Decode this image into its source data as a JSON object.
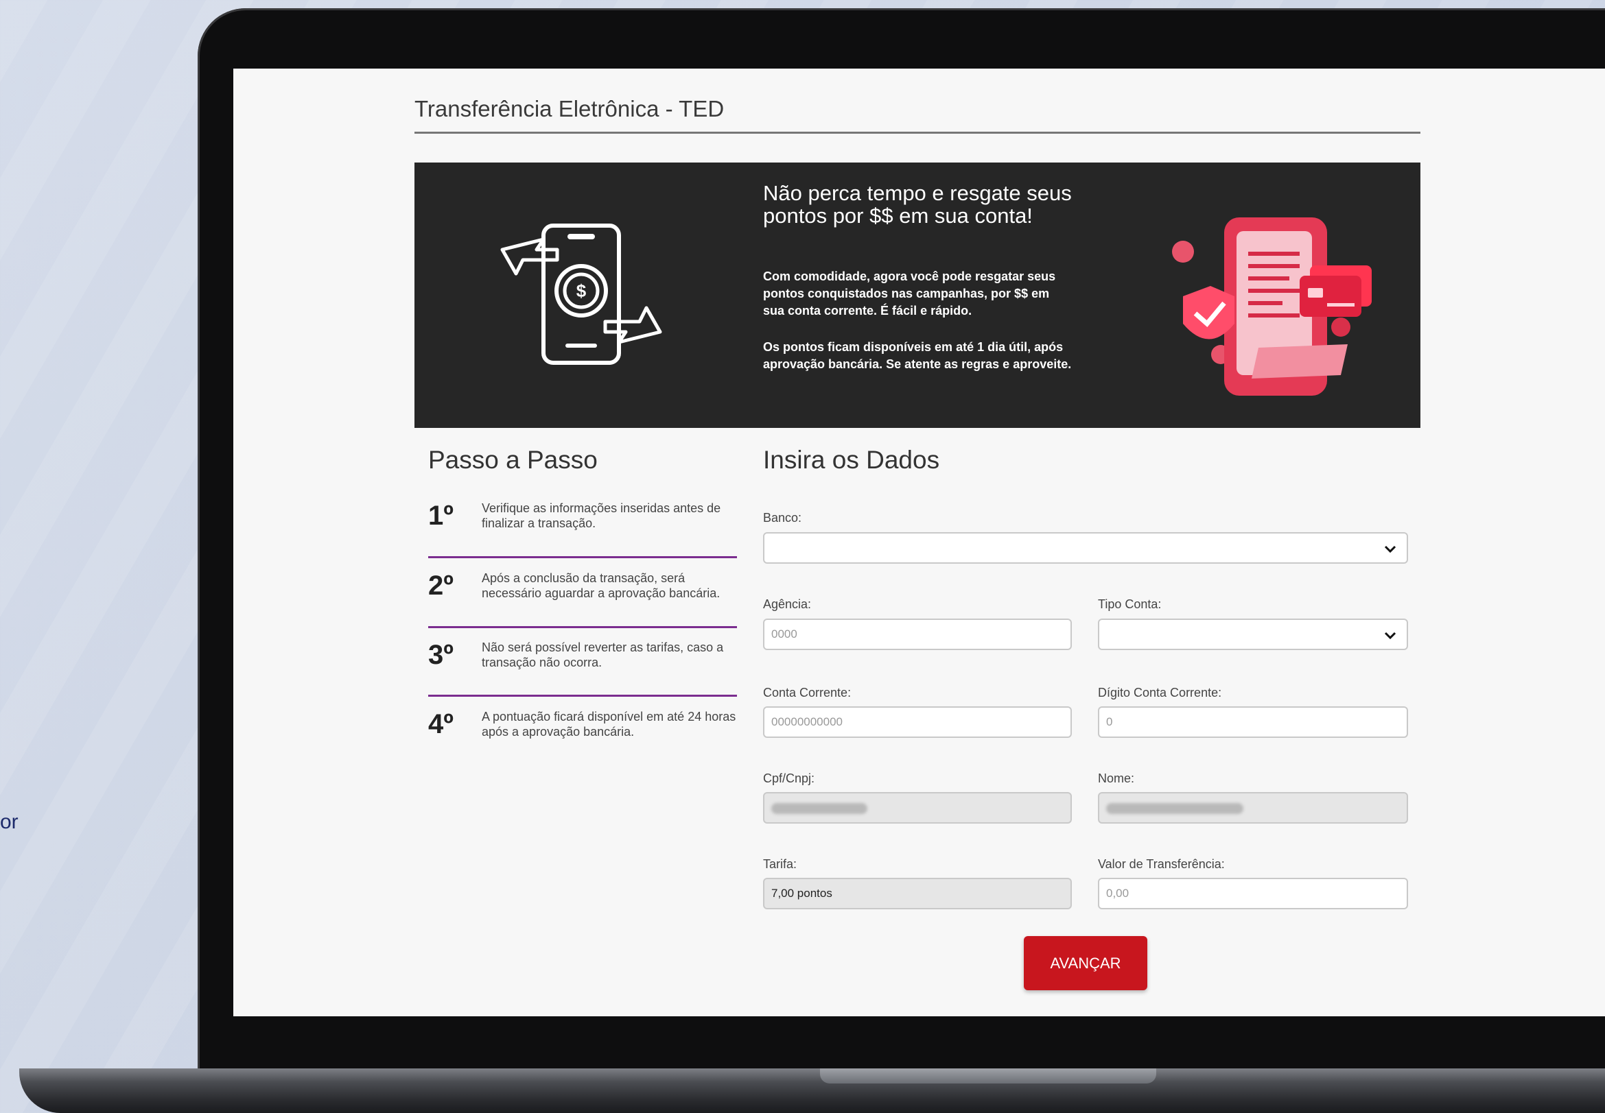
{
  "side_text": "or",
  "page": {
    "title": "Transferência Eletrônica - TED"
  },
  "banner": {
    "heading": "Não perca tempo e resgate seus pontos por $$ em sua conta!",
    "paragraph1": "Com comodidade, agora você pode resgatar seus pontos conquistados nas campanhas, por $$ em sua conta corrente. É fácil e rápido.",
    "paragraph2": "Os pontos ficam disponíveis em até 1 dia útil, após aprovação bancária. Se atente as regras e aproveite.",
    "icon_left": "phone-money-transfer-icon",
    "icon_right": "phone-receipt-card-illustration"
  },
  "steps": {
    "title": "Passo a Passo",
    "items": [
      {
        "num": "1º",
        "text": "Verifique as informações inseridas antes de finalizar a transação."
      },
      {
        "num": "2º",
        "text": "Após a conclusão da transação, será necessário aguardar a aprovação bancária."
      },
      {
        "num": "3º",
        "text": "Não será possível reverter as tarifas, caso a transação não ocorra."
      },
      {
        "num": "4º",
        "text": "A pontuação ficará disponível em até 24 horas após a aprovação bancária."
      }
    ]
  },
  "form": {
    "title": "Insira os Dados",
    "banco": {
      "label": "Banco:",
      "value": ""
    },
    "agencia": {
      "label": "Agência:",
      "placeholder": "0000"
    },
    "tipo_conta": {
      "label": "Tipo Conta:",
      "value": ""
    },
    "conta_corrente": {
      "label": "Conta Corrente:",
      "placeholder": "00000000000"
    },
    "digito": {
      "label": "Dígito Conta Corrente:",
      "placeholder": "0"
    },
    "cpf": {
      "label": "Cpf/Cnpj:"
    },
    "nome": {
      "label": "Nome:"
    },
    "tarifa": {
      "label": "Tarifa:",
      "value": "7,00 pontos"
    },
    "valor": {
      "label": "Valor de Transferência:",
      "placeholder": "0,00"
    },
    "submit_label": "AVANÇAR"
  },
  "colors": {
    "accent_red": "#c8161e",
    "step_rule": "#7b2d8f",
    "banner_bg": "#262626"
  }
}
